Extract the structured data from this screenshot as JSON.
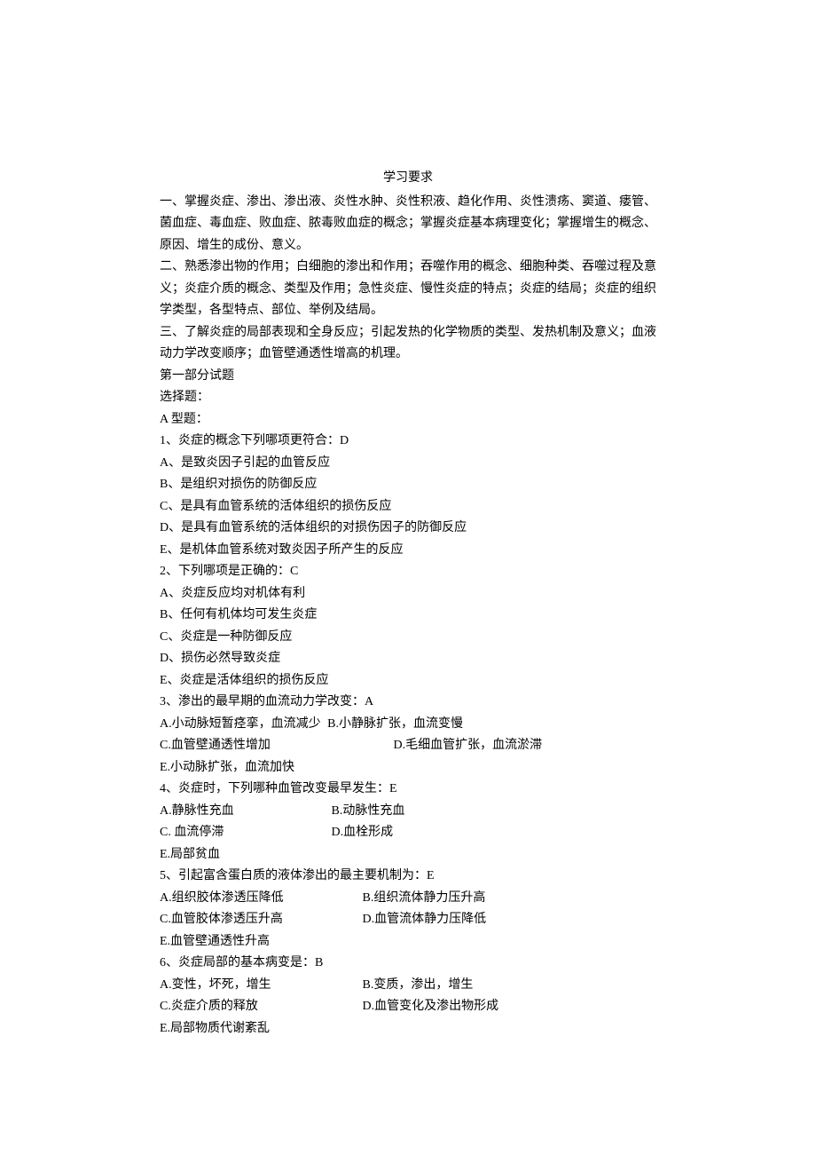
{
  "title": "学习要求",
  "reqs": [
    "一、掌握炎症、渗出、渗出液、炎性水肿、炎性积液、趋化作用、炎性溃疡、窦道、瘘管、菌血症、毒血症、败血症、脓毒败血症的概念；掌握炎症基本病理变化；掌握增生的概念、原因、增生的成份、意义。",
    "二、熟悉渗出物的作用；白细胞的渗出和作用；吞噬作用的概念、细胞种类、吞噬过程及意义；炎症介质的概念、类型及作用；急性炎症、慢性炎症的特点；炎症的结局；炎症的组织学类型，各型特点、部位、举例及结局。",
    "三、了解炎症的局部表现和全身反应；引起发热的化学物质的类型、发热机制及意义；血液动力学改变顺序；血管壁通透性增高的机理。"
  ],
  "section1": "第一部分试题",
  "selectLabel": "选择题：",
  "aType": "A 型题：",
  "q1": {
    "stem": "1、炎症的概念下列哪项更符合：D",
    "opts": [
      "A、是致炎因子引起的血管反应",
      "B、是组织对损伤的防御反应",
      "C、是具有血管系统的活体组织的损伤反应",
      "D、是具有血管系统的活体组织的对损伤因子的防御反应",
      "E、是机体血管系统对致炎因子所产生的反应"
    ]
  },
  "q2": {
    "stem": "2、下列哪项是正确的：C",
    "opts": [
      "A、炎症反应均对机体有利",
      "B、任何有机体均可发生炎症",
      "C、炎症是一种防御反应",
      "D、损伤必然导致炎症",
      "E、炎症是活体组织的损伤反应"
    ]
  },
  "q3": {
    "stem": "3、渗出的最早期的血流动力学改变：A",
    "line1_left": "A.小动脉短暂痉挛，血流减少",
    "line1_right": "B.小静脉扩张，血流变慢",
    "line2_left": "C.血管壁通透性增加",
    "line2_right": "D.毛细血管扩张，血流淤滞",
    "line3": "E.小动脉扩张，血流加快"
  },
  "q4": {
    "stem": "4、炎症时，下列哪种血管改变最早发生：E",
    "line1_left": "A.静脉性充血",
    "line1_right": "B.动脉性充血",
    "line2_left": "C. 血流停滞",
    "line2_right": "D.血栓形成",
    "line3": "E.局部贫血"
  },
  "q5": {
    "stem": "5、引起富含蛋白质的液体渗出的最主要机制为：E",
    "line1_left": "A.组织胶体渗透压降低",
    "line1_right": "B.组织流体静力压升高",
    "line2_left": "C.血管胶体渗透压升高",
    "line2_right": "D.血管流体静力压降低",
    "line3": "E.血管壁通透性升高"
  },
  "q6": {
    "stem": "6、炎症局部的基本病变是：B",
    "line1_left": "A.变性，坏死，增生",
    "line1_right": "B.变质，渗出，增生",
    "line2_left": "C.炎症介质的释放",
    "line2_right": "D.血管变化及渗出物形成",
    "line3": "E.局部物质代谢紊乱"
  }
}
